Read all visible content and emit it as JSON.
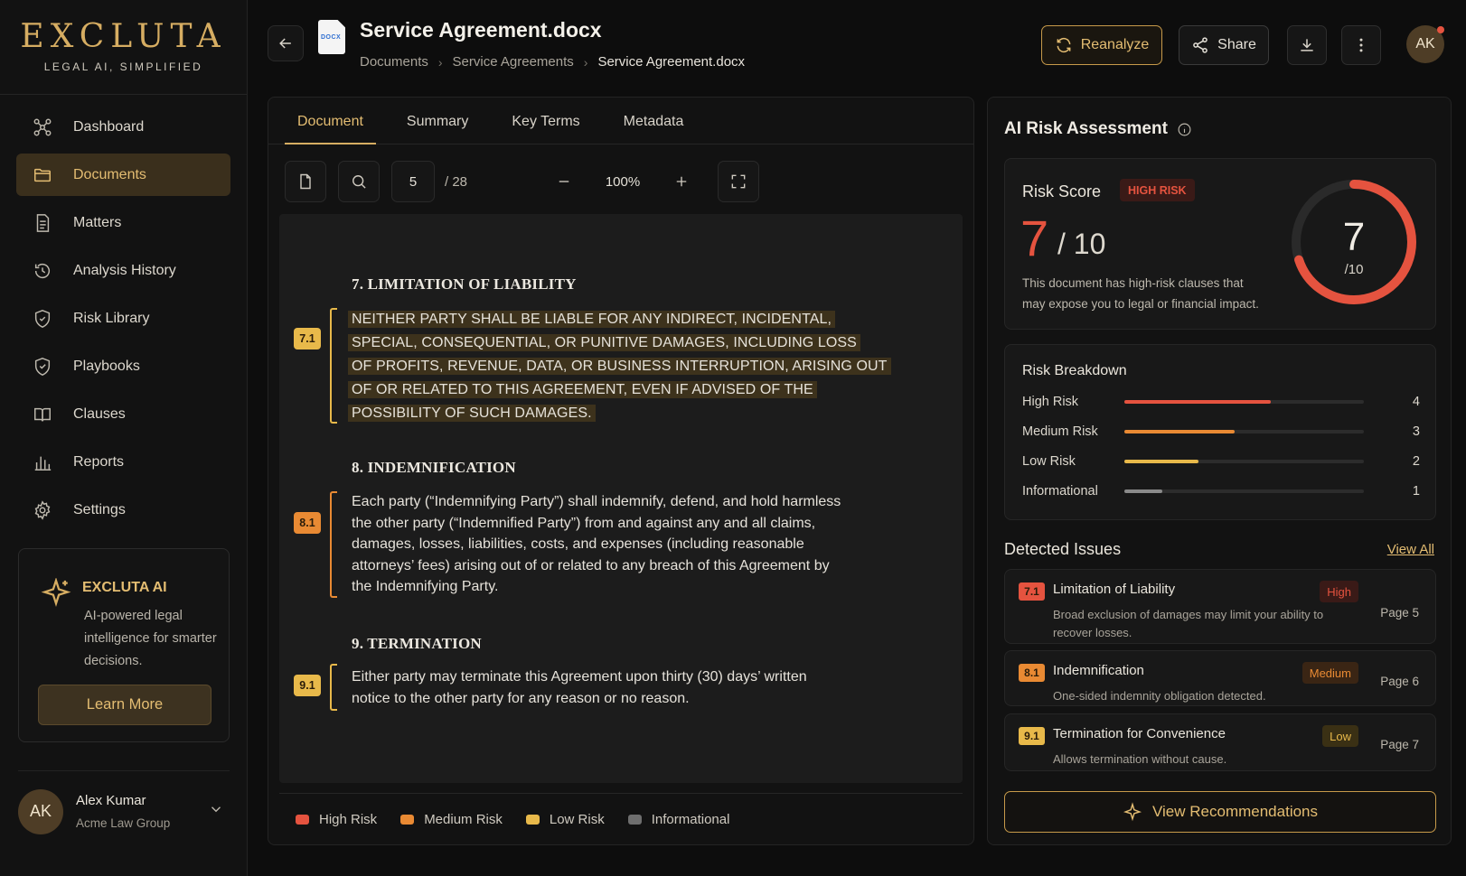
{
  "brand": {
    "name": "EXCLUTA",
    "tagline": "LEGAL AI, SIMPLIFIED"
  },
  "sidebar": {
    "items": [
      {
        "label": "Dashboard",
        "icon": "network-icon"
      },
      {
        "label": "Documents",
        "icon": "folder-icon",
        "active": true
      },
      {
        "label": "Matters",
        "icon": "file-text-icon"
      },
      {
        "label": "Analysis History",
        "icon": "history-icon"
      },
      {
        "label": "Risk Library",
        "icon": "shield-icon"
      },
      {
        "label": "Playbooks",
        "icon": "shield-check-icon"
      },
      {
        "label": "Clauses",
        "icon": "book-icon"
      },
      {
        "label": "Reports",
        "icon": "bar-chart-icon"
      },
      {
        "label": "Settings",
        "icon": "gear-icon"
      }
    ],
    "ai_card": {
      "title": "EXCLUTA AI",
      "description": "AI-powered legal intelligence for smarter decisions.",
      "button": "Learn More"
    },
    "user": {
      "initials": "AK",
      "name": "Alex Kumar",
      "org": "Acme Law Group"
    }
  },
  "header": {
    "file_badge": "DOCX",
    "title": "Service Agreement.docx",
    "breadcrumb": [
      "Documents",
      "Service Agreements",
      "Service Agreement.docx"
    ],
    "reanalyze": "Reanalyze",
    "share": "Share",
    "avatar": "AK"
  },
  "viewer": {
    "tabs": [
      "Document",
      "Summary",
      "Key Terms",
      "Metadata"
    ],
    "active_tab": "Document",
    "page": "5",
    "page_total": "/ 28",
    "zoom": "100%",
    "sections": [
      {
        "title": "7. LIMITATION OF LIABILITY",
        "tag": "7.1",
        "lines": [
          "NEITHER PARTY SHALL BE LIABLE FOR ANY INDIRECT, INCIDENTAL,",
          "SPECIAL, CONSEQUENTIAL, OR PUNITIVE DAMAGES, INCLUDING LOSS",
          "OF PROFITS, REVENUE, DATA, OR BUSINESS INTERRUPTION, ARISING OUT",
          "OF OR RELATED TO THIS AGREEMENT, EVEN IF ADVISED OF THE",
          "POSSIBILITY OF SUCH DAMAGES."
        ]
      },
      {
        "title": "8. INDEMNIFICATION",
        "tag": "8.1",
        "lines": [
          "Each party (“Indemnifying Party”) shall indemnify, defend, and hold harmless",
          "the other party (“Indemnified Party”) from and against any and all claims,",
          "damages, losses, liabilities, costs, and expenses (including reasonable",
          "attorneys’ fees) arising out of or related to any breach of this Agreement by",
          "the Indemnifying Party."
        ]
      },
      {
        "title": "9. TERMINATION",
        "tag": "9.1",
        "lines": [
          "Either party may terminate this Agreement upon thirty (30) days’ written",
          "notice to the other party for any reason or no reason."
        ]
      }
    ],
    "legend": [
      {
        "label": "High Risk",
        "color": "#e5533f"
      },
      {
        "label": "Medium Risk",
        "color": "#e98a33"
      },
      {
        "label": "Low Risk",
        "color": "#e8b94a"
      },
      {
        "label": "Informational",
        "color": "#6e6e6e"
      }
    ]
  },
  "assessment": {
    "title": "AI Risk Assessment",
    "score_label": "Risk Score",
    "badge": "HIGH RISK",
    "score": "7",
    "score_of": "/ 10",
    "score_fraction": 0.7,
    "gauge_den": "/10",
    "description": "This document has high-risk clauses that may expose you to legal or financial impact.",
    "breakdown_title": "Risk Breakdown",
    "breakdown": [
      {
        "label": "High Risk",
        "count": "4",
        "value": 0.61,
        "color": "#e5533f"
      },
      {
        "label": "Medium Risk",
        "count": "3",
        "value": 0.46,
        "color": "#e98a33"
      },
      {
        "label": "Low Risk",
        "count": "2",
        "value": 0.31,
        "color": "#e8b94a"
      },
      {
        "label": "Informational",
        "count": "1",
        "value": 0.16,
        "color": "#8a8a8a"
      }
    ],
    "issues_title": "Detected Issues",
    "view_all": "View All",
    "issues": [
      {
        "tag": "7.1",
        "title": "Limitation of Liability",
        "severity": "High",
        "desc": "Broad exclusion of damages may limit your ability to recover losses.",
        "page": "Page 5"
      },
      {
        "tag": "8.1",
        "title": "Indemnification",
        "severity": "Medium",
        "desc": "One-sided indemnity obligation detected.",
        "page": "Page 6"
      },
      {
        "tag": "9.1",
        "title": "Termination for Convenience",
        "severity": "Low",
        "desc": "Allows termination without cause.",
        "page": "Page 7"
      }
    ],
    "recommendations": "View Recommendations"
  }
}
